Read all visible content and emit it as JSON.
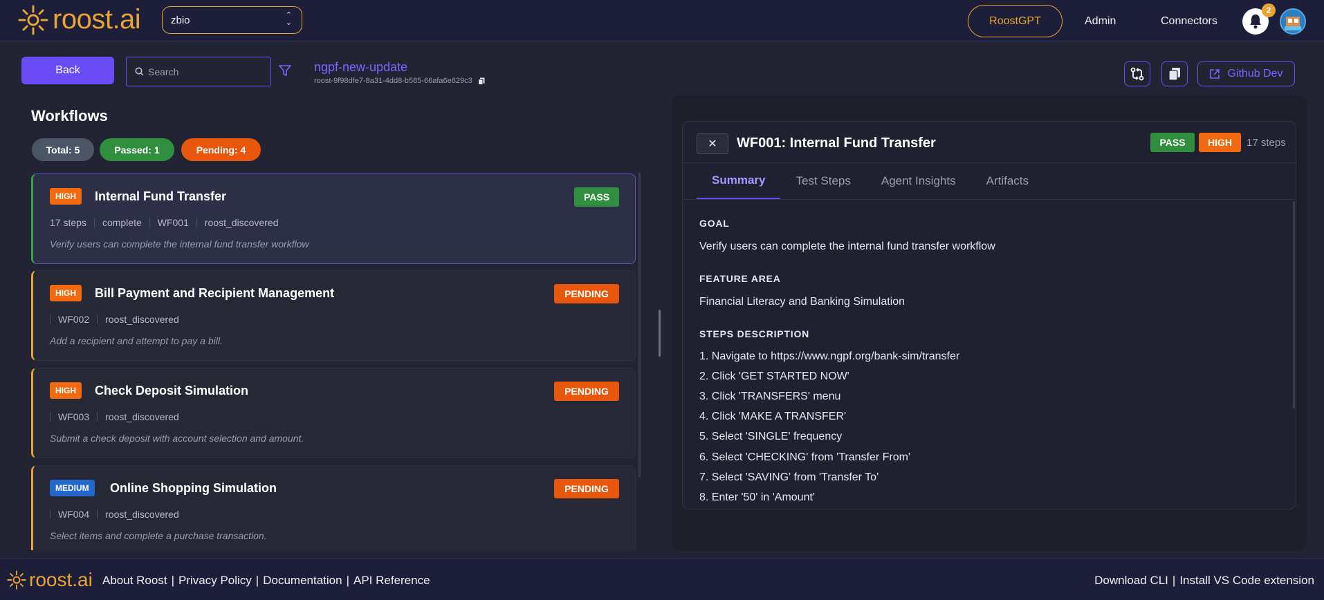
{
  "header": {
    "logo_text": "roost",
    "logo_suffix": ".ai",
    "org_selected": "zbio",
    "nav": {
      "roostgpt": "RoostGPT",
      "admin": "Admin",
      "connectors": "Connectors"
    },
    "notification_count": "2"
  },
  "toolbar": {
    "back_label": "Back",
    "search_placeholder": "Search",
    "repo_name": "ngpf-new-update",
    "repo_id": "roost-9f98dfe7-8a31-4dd8-b585-66afa6e629c3",
    "github_label": "Github Dev"
  },
  "workflows": {
    "title": "Workflows",
    "stats": {
      "total": "Total: 5",
      "passed": "Passed: 1",
      "pending": "Pending: 4"
    },
    "items": [
      {
        "priority": "HIGH",
        "name": "Internal Fund Transfer",
        "status": "PASS",
        "meta": [
          "17 steps",
          "complete",
          "WF001",
          "roost_discovered"
        ],
        "description": "Verify users can complete the internal fund transfer workflow"
      },
      {
        "priority": "HIGH",
        "name": "Bill Payment and Recipient Management",
        "status": "PENDING",
        "meta": [
          "WF002",
          "roost_discovered"
        ],
        "description": "Add a recipient and attempt to pay a bill."
      },
      {
        "priority": "HIGH",
        "name": "Check Deposit Simulation",
        "status": "PENDING",
        "meta": [
          "WF003",
          "roost_discovered"
        ],
        "description": "Submit a check deposit with account selection and amount."
      },
      {
        "priority": "MEDIUM",
        "name": "Online Shopping Simulation",
        "status": "PENDING",
        "meta": [
          "WF004",
          "roost_discovered"
        ],
        "description": "Select items and complete a purchase transaction."
      }
    ]
  },
  "detail": {
    "close_label": "✕",
    "title": "WF001: Internal Fund Transfer",
    "status": "PASS",
    "priority": "HIGH",
    "steps_count": "17 steps",
    "tabs": [
      "Summary",
      "Test Steps",
      "Agent Insights",
      "Artifacts"
    ],
    "goal_label": "GOAL",
    "goal": "Verify users can complete the internal fund transfer workflow",
    "feature_label": "FEATURE AREA",
    "feature": "Financial Literacy and Banking Simulation",
    "steps_label": "STEPS DESCRIPTION",
    "steps": [
      "1. Navigate to https://www.ngpf.org/bank-sim/transfer",
      "2. Click 'GET STARTED NOW'",
      "3. Click 'TRANSFERS' menu",
      "4. Click 'MAKE A TRANSFER'",
      "5. Select 'SINGLE' frequency",
      "6. Select 'CHECKING' from 'Transfer From'",
      "7. Select 'SAVING' from 'Transfer To'",
      "8. Enter '50' in 'Amount'"
    ]
  },
  "footer": {
    "logo_text": "roost",
    "logo_suffix": ".ai",
    "links": [
      "About Roost",
      "|",
      "Privacy Policy",
      "|",
      "Documentation",
      "|",
      "API Reference"
    ],
    "right_links": [
      "Download CLI",
      "|",
      "Install VS Code extension"
    ]
  },
  "colors": {
    "accent": "#6a4cf6",
    "brand": "#e9a431",
    "pass": "#2f8f3e",
    "pending": "#e8570c",
    "high": "#f26a0f",
    "medium": "#2267c9"
  },
  "icons": [
    "sun-logo-icon",
    "chevron-updown-icon",
    "bell-icon",
    "avatar-icon",
    "search-icon",
    "filter-icon",
    "copy-icon",
    "git-compare-icon",
    "clipboard-icon",
    "external-link-icon",
    "close-icon"
  ]
}
